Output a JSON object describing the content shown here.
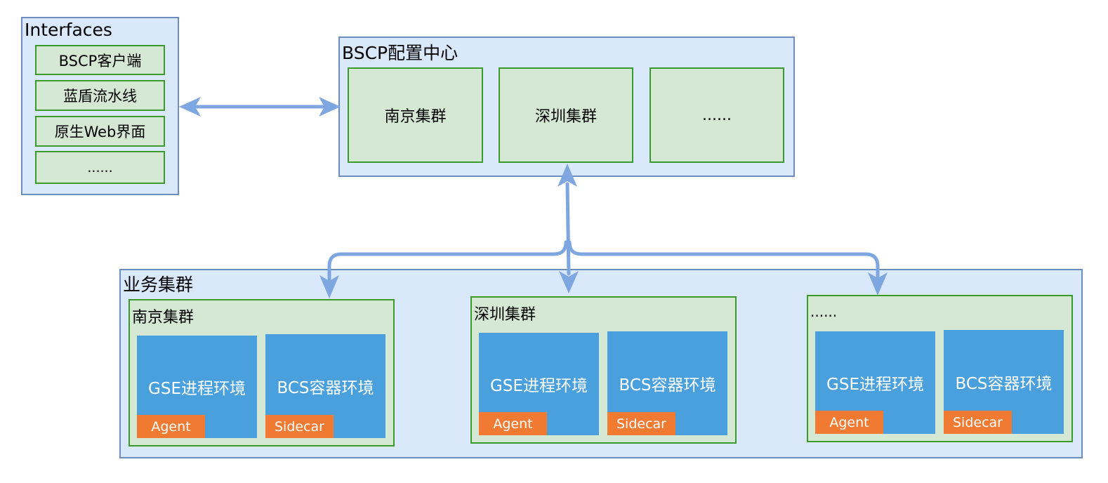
{
  "interfaces": {
    "title": "Interfaces",
    "items": [
      "BSCP客户端",
      "蓝盾流水线",
      "原生Web界面",
      "......"
    ]
  },
  "config_center": {
    "title": "BSCP配置中心",
    "clusters": [
      "南京集群",
      "深圳集群",
      "......"
    ]
  },
  "business": {
    "title": "业务集群",
    "clusters": [
      {
        "name": "南京集群",
        "gse": "GSE进程环境",
        "agent": "Agent",
        "bcs": "BCS容器环境",
        "sidecar": "Sidecar"
      },
      {
        "name": "深圳集群",
        "gse": "GSE进程环境",
        "agent": "Agent",
        "bcs": "BCS容器环境",
        "sidecar": "Sidecar"
      },
      {
        "name": "......",
        "gse": "GSE进程环境",
        "agent": "Agent",
        "bcs": "BCS容器环境",
        "sidecar": "Sidecar"
      }
    ]
  },
  "colors": {
    "container_fill": "#dae8fc",
    "container_border": "#6c8ebf",
    "cluster_fill": "#d5e8d4",
    "cluster_border": "#3a9b2a",
    "env_fill": "#4aa0dc",
    "tag_fill": "#f07a31",
    "arrow": "#7ea6e0"
  }
}
